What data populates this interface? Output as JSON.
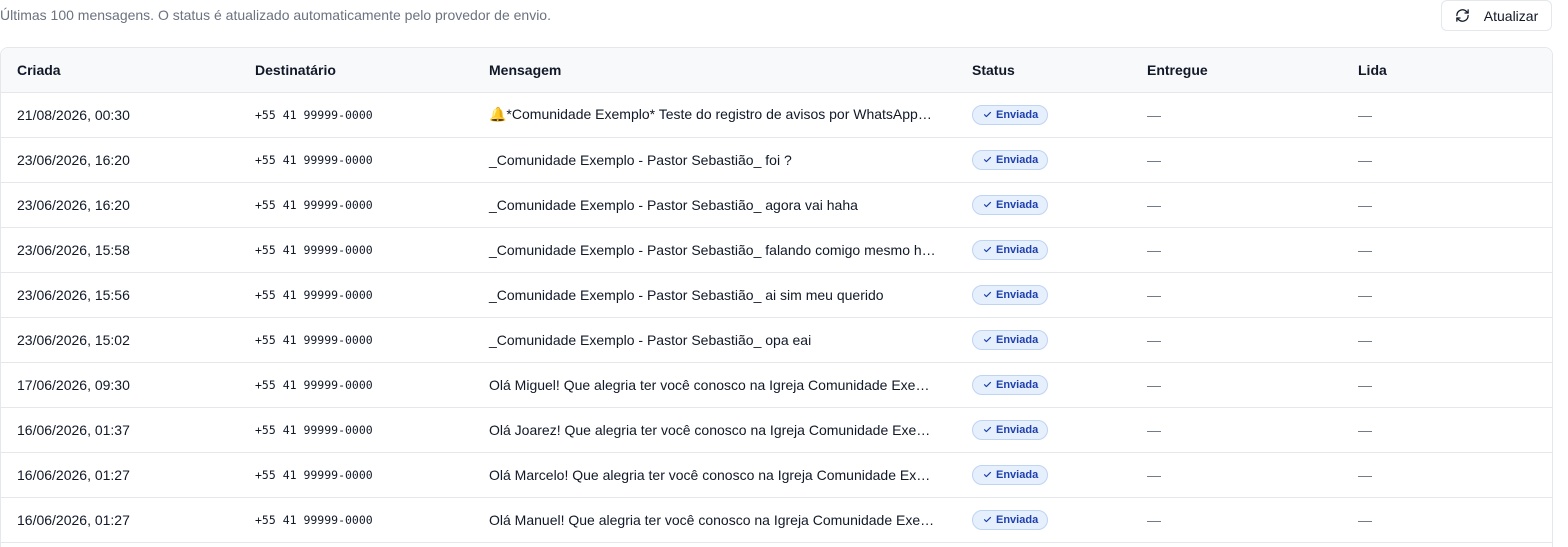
{
  "header": {
    "subtitle": "Últimas 100 mensagens. O status é atualizado automaticamente pelo provedor de envio.",
    "refresh_label": "Atualizar",
    "refresh_icon": "refresh-icon"
  },
  "table": {
    "columns": [
      "Criada",
      "Destinatário",
      "Mensagem",
      "Status",
      "Entregue",
      "Lida"
    ],
    "rows": [
      {
        "criada": "21/08/2026, 00:30",
        "destinatario": "+55 41 99999-0000",
        "mensagem": "🔔*Comunidade Exemplo* Teste do registro de avisos por WhatsApp…",
        "status": "Enviada",
        "entregue": "—",
        "lida": "—"
      },
      {
        "criada": "23/06/2026, 16:20",
        "destinatario": "+55 41 99999-0000",
        "mensagem": "_Comunidade Exemplo - Pastor Sebastião_ foi ?",
        "status": "Enviada",
        "entregue": "—",
        "lida": "—"
      },
      {
        "criada": "23/06/2026, 16:20",
        "destinatario": "+55 41 99999-0000",
        "mensagem": "_Comunidade Exemplo - Pastor Sebastião_ agora vai haha",
        "status": "Enviada",
        "entregue": "—",
        "lida": "—"
      },
      {
        "criada": "23/06/2026, 15:58",
        "destinatario": "+55 41 99999-0000",
        "mensagem": "_Comunidade Exemplo - Pastor Sebastião_ falando comigo mesmo h…",
        "status": "Enviada",
        "entregue": "—",
        "lida": "—"
      },
      {
        "criada": "23/06/2026, 15:56",
        "destinatario": "+55 41 99999-0000",
        "mensagem": "_Comunidade Exemplo - Pastor Sebastião_ ai sim meu querido",
        "status": "Enviada",
        "entregue": "—",
        "lida": "—"
      },
      {
        "criada": "23/06/2026, 15:02",
        "destinatario": "+55 41 99999-0000",
        "mensagem": "_Comunidade Exemplo - Pastor Sebastião_ opa eai",
        "status": "Enviada",
        "entregue": "—",
        "lida": "—"
      },
      {
        "criada": "17/06/2026, 09:30",
        "destinatario": "+55 41 99999-0000",
        "mensagem": "Olá Miguel! Que alegria ter você conosco na Igreja Comunidade Exe…",
        "status": "Enviada",
        "entregue": "—",
        "lida": "—"
      },
      {
        "criada": "16/06/2026, 01:37",
        "destinatario": "+55 41 99999-0000",
        "mensagem": "Olá Joarez! Que alegria ter você conosco na Igreja Comunidade Exe…",
        "status": "Enviada",
        "entregue": "—",
        "lida": "—"
      },
      {
        "criada": "16/06/2026, 01:27",
        "destinatario": "+55 41 99999-0000",
        "mensagem": "Olá Marcelo! Que alegria ter você conosco na Igreja Comunidade Ex…",
        "status": "Enviada",
        "entregue": "—",
        "lida": "—"
      },
      {
        "criada": "16/06/2026, 01:27",
        "destinatario": "+55 41 99999-0000",
        "mensagem": "Olá Manuel! Que alegria ter você conosco na Igreja Comunidade Exe…",
        "status": "Enviada",
        "entregue": "—",
        "lida": "—"
      }
    ]
  },
  "colors": {
    "badge_bg": "#e6effc",
    "badge_border": "#bfd3f2",
    "badge_text": "#1e40af",
    "header_bg": "#f8f9fb",
    "border": "#e5e7eb",
    "muted_text": "#6b7280"
  }
}
